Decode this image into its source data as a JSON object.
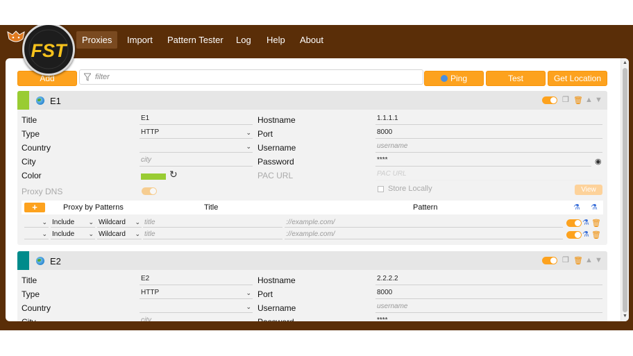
{
  "nav": {
    "tabs": [
      "Proxies",
      "Import",
      "Pattern Tester",
      "Log",
      "Help",
      "About"
    ],
    "active": "Proxies",
    "logo_text": "FST"
  },
  "toolbar": {
    "add_label": "Add",
    "filter_placeholder": "filter",
    "ping_label": "Ping",
    "test_label": "Test",
    "get_location_label": "Get Location"
  },
  "form_labels": {
    "title": "Title",
    "type": "Type",
    "country": "Country",
    "city": "City",
    "color": "Color",
    "proxy_dns": "Proxy DNS",
    "hostname": "Hostname",
    "port": "Port",
    "username": "Username",
    "password": "Password",
    "pac_url": "PAC URL",
    "store_locally": "Store Locally",
    "view": "View"
  },
  "patterns_header": {
    "plus": "+",
    "proxy_by_patterns": "Proxy by Patterns",
    "title": "Title",
    "pattern": "Pattern"
  },
  "proxies": [
    {
      "name": "E1",
      "accent": "#99cc33",
      "title": "E1",
      "type": "HTTP",
      "country": "",
      "city_placeholder": "city",
      "hostname": "1.1.1.1",
      "port": "8000",
      "username_placeholder": "username",
      "password": "****",
      "pac_placeholder": "PAC URL",
      "color": "#99cc33",
      "patterns": [
        {
          "include": "Include",
          "kind": "Wildcard",
          "title_placeholder": "title",
          "pattern_placeholder": "://example.com/"
        },
        {
          "include": "Include",
          "kind": "Wildcard",
          "title_placeholder": "title",
          "pattern_placeholder": "://example.com/"
        }
      ]
    },
    {
      "name": "E2",
      "accent": "#008b8b",
      "title": "E2",
      "type": "HTTP",
      "country": "",
      "city_placeholder": "city",
      "hostname": "2.2.2.2",
      "port": "8000",
      "username_placeholder": "username",
      "password": "****"
    }
  ],
  "colors": {
    "accent": "#fda21e",
    "frame": "#5a2e08",
    "nav_active": "#7a4a20"
  },
  "icons": [
    "fox-icon",
    "globe-icon",
    "copy-icon",
    "trash-icon",
    "up-arrow-icon",
    "down-arrow-icon",
    "refresh-icon",
    "eye-icon",
    "flask-icon",
    "filter-icon",
    "ping-icon"
  ]
}
